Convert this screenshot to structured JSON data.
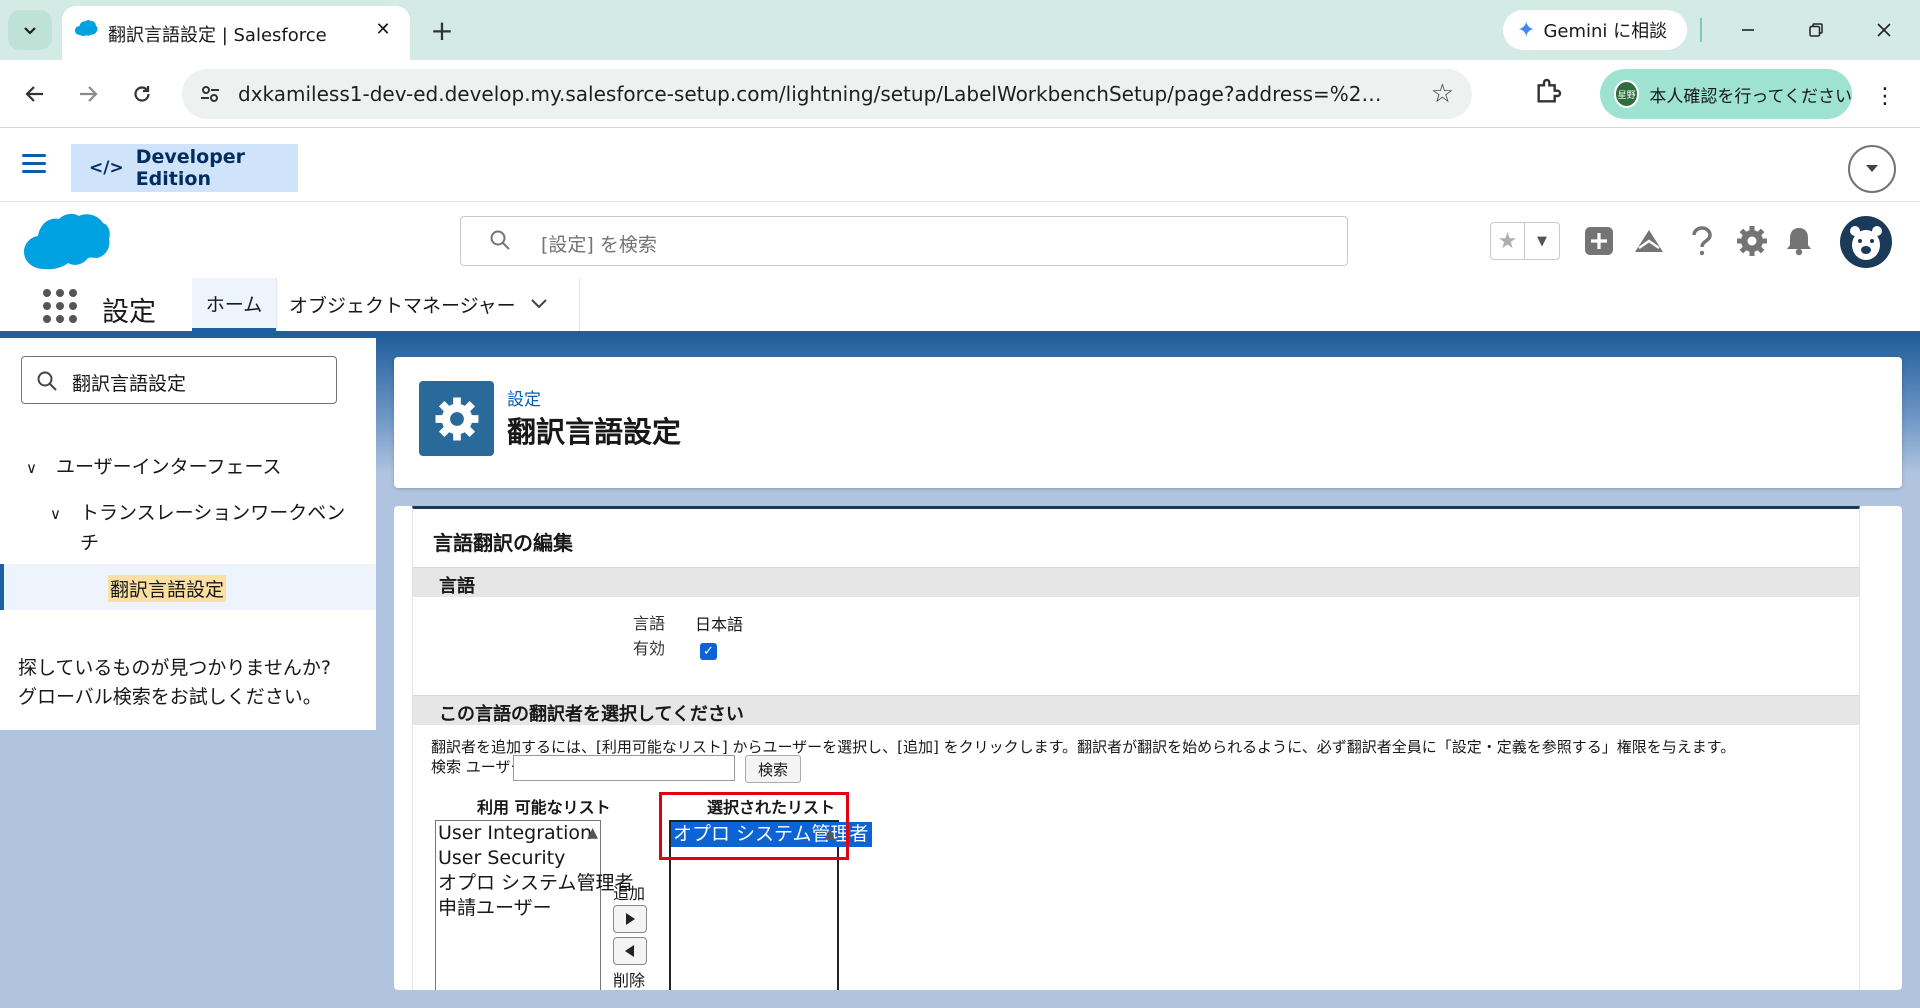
{
  "browser": {
    "tab_title": "翻訳言語設定 | Salesforce",
    "tab_close": "✕",
    "newtab": "+",
    "gemini_label": "Gemini に相談",
    "address_url": "dxkamiless1-dev-ed.develop.my.salesforce-setup.com/lightning/setup/LabelWorkbenchSetup/page?address=%2F01h5i000000T...",
    "profile_label": "本人確認を行ってください",
    "profile_avatar_text": "星野"
  },
  "sf": {
    "edition_label": "Developer Edition",
    "search_placeholder": "[設定] を検索",
    "app_name": "設定",
    "nav_home": "ホーム",
    "nav_object_manager": "オブジェクトマネージャー"
  },
  "sidebar": {
    "quickfind_value": "翻訳言語設定",
    "tree": {
      "level1": "ユーザーインターフェース",
      "level2_line1": "トランスレーションワークベン",
      "level2_line2": "チ",
      "level3": "翻訳言語設定"
    },
    "help_line1": "探しているものが見つかりませんか?",
    "help_line2": "グローバル検索をお試しください。"
  },
  "page_header": {
    "breadcrumb": "設定",
    "title": "翻訳言語設定"
  },
  "panel": {
    "title": "言語翻訳の編集",
    "section_language": "言語",
    "field_language_label": "言語",
    "field_language_value": "日本語",
    "field_active_label": "有効",
    "field_active_checked": true,
    "section_translators": "この言語の翻訳者を選択してください",
    "description": "翻訳者を追加するには、[利用可能なリスト] からユーザーを選択し、[追加] をクリックします。翻訳者が翻訳を始められるように、必ず翻訳者全員に「設定・定義を参照する」権限を与えます。",
    "search_user_label": "検索 ユーザー",
    "search_button": "検索",
    "available_header": "利用 可能なリスト",
    "available_items": [
      "User Integration",
      "User Security",
      "オプロ システム管理者",
      "申請ユーザー"
    ],
    "selected_header": "選択されたリスト",
    "selected_items": [
      "オプロ システム管理者"
    ],
    "add_label": "追加",
    "remove_label": "削除"
  },
  "colors": {
    "sf_brand_blue": "#0b5cab",
    "selection_blue": "#0b63d6",
    "highlight_red": "#e3000f",
    "chrome_tabbar": "#d3ebe4"
  }
}
